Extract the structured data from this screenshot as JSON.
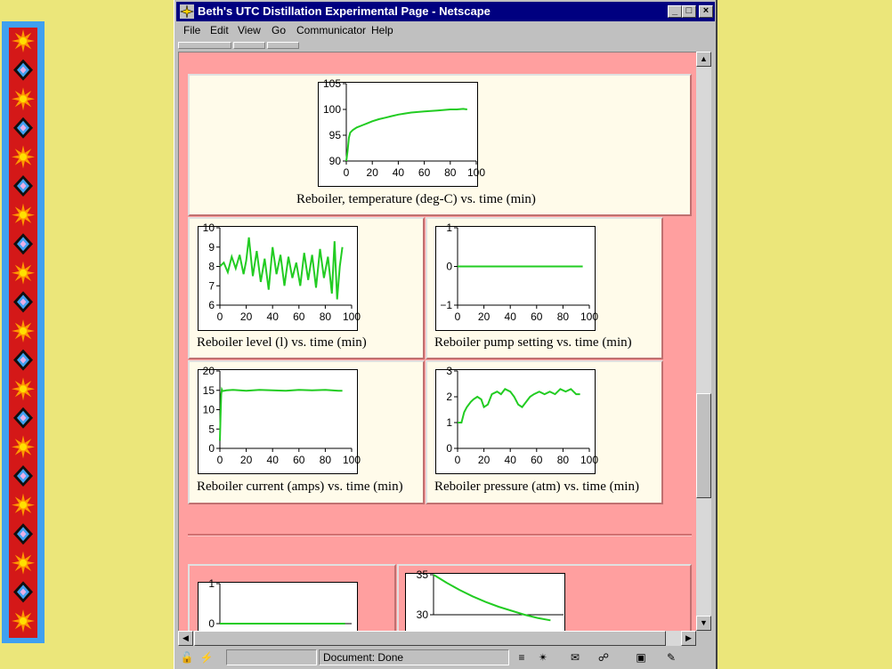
{
  "window": {
    "title": "Beth's UTC Distillation Experimental Page - Netscape",
    "minimize": "_",
    "maximize": "□",
    "close": "×"
  },
  "menu": [
    "File",
    "Edit",
    "View",
    "Go",
    "Communicator",
    "Help"
  ],
  "status": {
    "text": "Document: Done"
  },
  "colors": {
    "page_background": "#EBE67A",
    "content_background": "#FF9F9F",
    "cell_background": "#FFFBEA",
    "trace": "#22CC22",
    "titlebar": "#000080"
  },
  "icons": [
    "lock-icon",
    "plug-icon",
    "security-icon",
    "component-bar-icons"
  ],
  "captions": {
    "reboiler_temperature": "Reboiler, temperature (deg-C) vs. time (min)",
    "reboiler_level": "Reboiler level (l) vs. time (min)",
    "reboiler_pump": "Reboiler pump setting vs. time (min)",
    "reboiler_current": "Reboiler current (amps) vs. time (min)",
    "reboiler_pressure": "Reboiler pressure (atm) vs. time (min)"
  },
  "chart_data": [
    {
      "id": "temp",
      "type": "line",
      "xlim": [
        0,
        100
      ],
      "ylim": [
        90,
        105
      ],
      "xticks": [
        0,
        20,
        40,
        60,
        80,
        100
      ],
      "yticks": [
        90,
        95,
        100,
        105
      ],
      "x": [
        0,
        1,
        2,
        3,
        5,
        8,
        12,
        16,
        20,
        25,
        30,
        35,
        40,
        45,
        50,
        55,
        60,
        65,
        70,
        75,
        80,
        85,
        90,
        93
      ],
      "values": [
        90,
        92,
        94.5,
        95.5,
        96,
        96.5,
        96.9,
        97.3,
        97.7,
        98.1,
        98.4,
        98.7,
        99.0,
        99.2,
        99.4,
        99.5,
        99.6,
        99.7,
        99.8,
        99.9,
        100,
        100,
        100.1,
        100
      ]
    },
    {
      "id": "level",
      "type": "line",
      "xlim": [
        0,
        100
      ],
      "ylim": [
        6,
        10
      ],
      "xticks": [
        0,
        20,
        40,
        60,
        80,
        100
      ],
      "yticks": [
        6,
        7,
        8,
        9,
        10
      ],
      "x": [
        0,
        3,
        6,
        9,
        12,
        15,
        18,
        20,
        22,
        25,
        28,
        31,
        34,
        37,
        40,
        43,
        46,
        49,
        52,
        55,
        58,
        61,
        64,
        67,
        70,
        73,
        76,
        79,
        82,
        85,
        87,
        89,
        91,
        93
      ],
      "values": [
        8.0,
        8.2,
        7.7,
        8.5,
        7.9,
        8.6,
        7.6,
        8.3,
        9.5,
        7.5,
        8.8,
        7.2,
        8.4,
        6.8,
        9.0,
        7.6,
        8.6,
        7.0,
        8.5,
        7.4,
        8.2,
        7.0,
        8.7,
        7.3,
        8.6,
        6.9,
        8.9,
        7.4,
        8.5,
        6.6,
        9.3,
        6.3,
        8.0,
        9.0
      ]
    },
    {
      "id": "pump",
      "type": "line",
      "xlim": [
        0,
        100
      ],
      "ylim": [
        -1,
        1
      ],
      "xticks": [
        0,
        20,
        40,
        60,
        80,
        100
      ],
      "yticks": [
        -1,
        0,
        1
      ],
      "x": [
        0,
        95
      ],
      "values": [
        0,
        0
      ]
    },
    {
      "id": "current",
      "type": "line",
      "xlim": [
        0,
        100
      ],
      "ylim": [
        0,
        20
      ],
      "xticks": [
        0,
        20,
        40,
        60,
        80,
        100
      ],
      "yticks": [
        0,
        5,
        10,
        15,
        20
      ],
      "x": [
        0,
        0.5,
        1,
        1.5,
        2,
        5,
        10,
        20,
        30,
        40,
        50,
        60,
        70,
        80,
        90,
        93
      ],
      "values": [
        2,
        8,
        14,
        15.2,
        14.8,
        15,
        15.1,
        14.9,
        15.1,
        15,
        14.9,
        15.1,
        15,
        15.1,
        14.9,
        14.9
      ]
    },
    {
      "id": "pressure",
      "type": "line",
      "xlim": [
        0,
        100
      ],
      "ylim": [
        0,
        3
      ],
      "xticks": [
        0,
        20,
        40,
        60,
        80,
        100
      ],
      "yticks": [
        0,
        1,
        2,
        3
      ],
      "x": [
        0,
        3,
        5,
        7,
        10,
        12,
        15,
        18,
        20,
        23,
        26,
        30,
        33,
        36,
        40,
        43,
        46,
        49,
        52,
        55,
        58,
        62,
        66,
        70,
        74,
        78,
        82,
        86,
        90,
        93
      ],
      "values": [
        1.0,
        1.0,
        1.4,
        1.6,
        1.8,
        1.9,
        2.0,
        1.9,
        1.6,
        1.7,
        2.1,
        2.2,
        2.1,
        2.3,
        2.2,
        2.0,
        1.7,
        1.6,
        1.8,
        2.0,
        2.1,
        2.2,
        2.1,
        2.2,
        2.1,
        2.3,
        2.2,
        2.3,
        2.1,
        2.1
      ]
    },
    {
      "id": "bottom_left",
      "type": "line",
      "xlim": [
        0,
        100
      ],
      "ylim": [
        0,
        1
      ],
      "yticks": [
        0,
        1
      ],
      "x": [
        0,
        95
      ],
      "values": [
        0,
        0
      ]
    },
    {
      "id": "bottom_right",
      "type": "line",
      "xlim": [
        0,
        100
      ],
      "ylim": [
        30,
        35
      ],
      "yticks": [
        30,
        35
      ],
      "x": [
        0,
        10,
        20,
        30,
        40,
        50,
        60,
        70,
        80,
        90
      ],
      "values": [
        35,
        34,
        33.1,
        32.3,
        31.6,
        31.0,
        30.5,
        30.0,
        29.6,
        29.3
      ]
    }
  ]
}
